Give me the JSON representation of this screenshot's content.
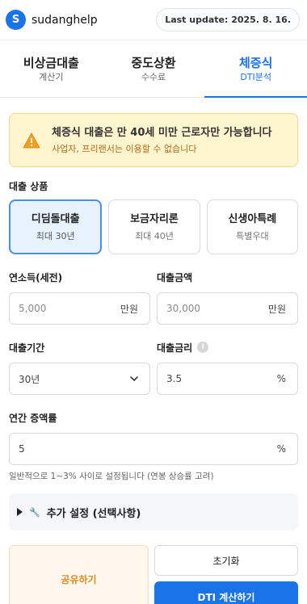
{
  "header": {
    "logo_letter": "S",
    "brand": "sudanghelp",
    "last_update": "Last update: 2025. 8. 16."
  },
  "tabs": [
    {
      "title": "비상금대출",
      "subtitle": "계산기",
      "active": false
    },
    {
      "title": "중도상환",
      "subtitle": "수수료",
      "active": false
    },
    {
      "title": "체증식",
      "subtitle": "DTI분석",
      "active": true
    }
  ],
  "alert": {
    "title": "체증식 대출은 만 40세 미만 근로자만 가능합니다",
    "subtitle": "사업자, 프리랜서는 이용할 수 없습니다",
    "icon": "warning-icon"
  },
  "products": {
    "label": "대출 상품",
    "items": [
      {
        "name": "디딤돌대출",
        "detail": "최대 30년",
        "selected": true
      },
      {
        "name": "보금자리론",
        "detail": "최대 40년",
        "selected": false
      },
      {
        "name": "신생아특례",
        "detail": "특별우대",
        "selected": false
      }
    ]
  },
  "income": {
    "label": "연소득(세전)",
    "placeholder": "5,000",
    "unit": "만원"
  },
  "loan_amount": {
    "label": "대출금액",
    "placeholder": "30,000",
    "unit": "만원"
  },
  "period": {
    "label": "대출기간",
    "value": "30년"
  },
  "rate": {
    "label": "대출금리",
    "value": "3.5",
    "unit": "%",
    "info_icon": "i"
  },
  "growth": {
    "label": "연간 증액률",
    "value": "5",
    "unit": "%",
    "hint": "일반적으로 1~3% 사이로 설정됩니다 (연봉 상승률 고려)"
  },
  "advanced": {
    "label": "추가 설정 (선택사항)",
    "icon": "wrench-icon"
  },
  "buttons": {
    "share": "공유하기",
    "reset": "초기화",
    "calculate": "DTI 계산하기"
  },
  "colors": {
    "accent": "#1a73e8",
    "warning_bg": "#fff5cf",
    "share_text": "#e08a1e"
  }
}
